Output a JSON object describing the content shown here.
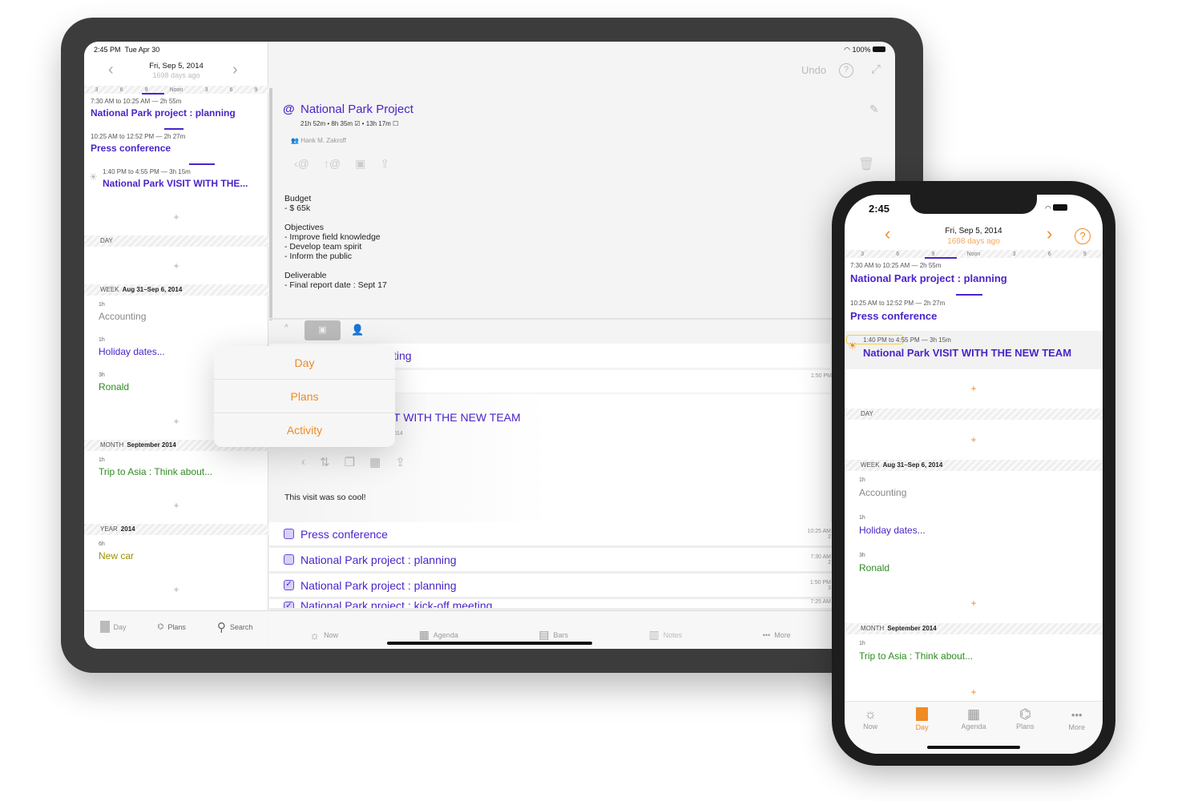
{
  "ipad": {
    "status": {
      "time": "2:45 PM",
      "date": "Tue Apr 30",
      "battery": "100%"
    },
    "left": {
      "date": "Fri, Sep 5, 2014",
      "days_ago": "1698 days ago",
      "ticks": [
        "3",
        "6",
        "9",
        "Noon",
        "3",
        "6",
        "9"
      ],
      "events": [
        {
          "time": "7:30 AM to 10:25 AM — 2h 55m",
          "title": "National Park project : planning"
        },
        {
          "time": "10:25 AM to 12:52 PM — 2h 27m",
          "title": "Press conference"
        },
        {
          "time": "1:40 PM to 4:55 PM — 3h 15m",
          "title": "National Park VISIT WITH THE..."
        }
      ],
      "plus": "+",
      "day_label": "DAY",
      "week": {
        "label": "WEEK",
        "range": "Aug 31–Sep 6, 2014",
        "items": [
          {
            "dur": "1h",
            "title": "Accounting"
          },
          {
            "dur": "1h",
            "title": "Holiday dates..."
          },
          {
            "dur": "3h",
            "title": "Ronald"
          }
        ]
      },
      "month": {
        "label": "MONTH",
        "range": "September 2014",
        "items": [
          {
            "dur": "1h",
            "title": "Trip to Asia : Think about..."
          }
        ]
      },
      "year": {
        "label": "YEAR",
        "range": "2014",
        "items": [
          {
            "dur": "6h",
            "title": "New car"
          }
        ]
      },
      "tabs": [
        "Day",
        "Plans",
        "Search"
      ]
    },
    "main": {
      "undo": "Undo",
      "title": "National Park Project",
      "stats": "21h 52m • 8h 35m ☑ • 13h 17m ☐",
      "person": "Hank M. Zakroff",
      "notes": [
        "Budget",
        "- $ 65k",
        "",
        "Objectives",
        "- Improve field knowledge",
        "- Develop team spirit",
        "- Inform the public",
        "",
        "Deliverable",
        "- Final report date : Sept 17"
      ],
      "partial1": "ting",
      "partial_time": "1:50 PM",
      "partial_dur": "3",
      "partial2": "T WITH THE NEW TEAM",
      "partial3": "014",
      "comment": "This visit was so cool!",
      "rows": [
        {
          "title": "Press conference",
          "checked": false,
          "time": "10:25 AM",
          "dur": "2"
        },
        {
          "title": "National Park project : planning",
          "checked": false,
          "time": "7:30 AM",
          "dur": "2"
        },
        {
          "title": "National Park project : planning",
          "checked": true,
          "time": "1:50 PM",
          "dur": "3"
        },
        {
          "title": "National Park project : kick-off meeting",
          "checked": true,
          "time": "7:25 AM",
          "dur": ""
        }
      ],
      "popup": [
        "Day",
        "Plans",
        "Activity"
      ],
      "tabs": [
        "Now",
        "Agenda",
        "Bars",
        "Notes",
        "More"
      ]
    }
  },
  "iphone": {
    "time": "2:45",
    "date": "Fri, Sep 5, 2014",
    "days_ago": "1698 days ago",
    "ticks": [
      "3",
      "6",
      "9",
      "Noon",
      "3",
      "6",
      "9"
    ],
    "events": [
      {
        "time": "7:30 AM to 10:25 AM — 2h 55m",
        "title": "National Park project : planning"
      },
      {
        "time": "10:25 AM to 12:52 PM — 2h 27m",
        "title": "Press conference"
      },
      {
        "time": "1:40 PM to 4:55 PM — 3h 15m",
        "title": "National Park VISIT WITH THE NEW TEAM"
      }
    ],
    "plus": "+",
    "day_label": "DAY",
    "week": {
      "label": "WEEK",
      "range": "Aug 31–Sep 6, 2014",
      "items": [
        {
          "dur": "1h",
          "title": "Accounting"
        },
        {
          "dur": "1h",
          "title": "Holiday dates..."
        },
        {
          "dur": "3h",
          "title": "Ronald"
        }
      ]
    },
    "month": {
      "label": "MONTH",
      "range": "September 2014",
      "items": [
        {
          "dur": "1h",
          "title": "Trip to Asia : Think about..."
        }
      ]
    },
    "tabs": [
      "Now",
      "Day",
      "Agenda",
      "Plans",
      "More"
    ],
    "active_tab": "Day"
  },
  "colors": {
    "accent": "#4a24c9",
    "orange": "#f08a24",
    "green": "#2f8a22",
    "olive": "#9a9400"
  }
}
